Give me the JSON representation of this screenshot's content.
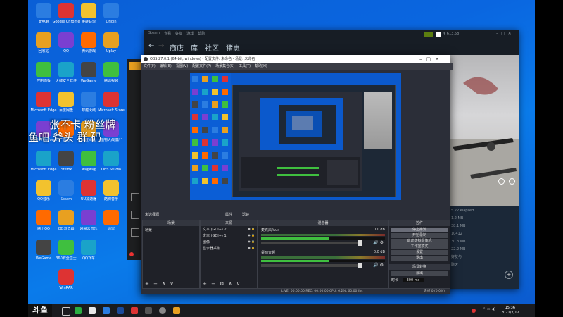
{
  "desktop": {
    "icons_col1": [
      "此电脑",
      "回收站",
      "控制面板",
      "Microsoft Edge",
      "NVIDIA GeForce Experience",
      "Microsoft Edge",
      "QQ音乐",
      "腾讯QQ",
      "WeGame"
    ],
    "icons_col2": [
      "Google Chrome",
      "QQ",
      "火绒安全软件",
      "百度网盘",
      "微信",
      "Firefox",
      "Steam",
      "QQ浏览器",
      "360安全卫士",
      "WinRAR"
    ],
    "icons_col3": [
      "英雄联盟",
      "腾讯游戏",
      "WeGame",
      "穿越火线",
      "百度网盘",
      "哔哩哔哩",
      "UU加速器",
      "网易云音乐",
      "QQ飞车"
    ],
    "icons_col4": [
      "Origin",
      "Uplay",
      "腾讯视频",
      "Microsoft Store",
      "植物大战僵尸",
      "OBS Studio",
      "酷狗音乐",
      "迅雷"
    ],
    "overlay_line1": "张不卡 粉丝牌",
    "overlay_line2": "鱼吧 斧头 群 码"
  },
  "steam": {
    "title_bar_items": [
      "Steam",
      "查看",
      "好友",
      "游戏",
      "帮助"
    ],
    "nav_back": "←",
    "nav_forward": "→",
    "nav_items": [
      "商店",
      "库",
      "社区",
      "猪崽"
    ],
    "user_balance": "¥ 613.58",
    "side_texts": [
      "5.22 elapsed",
      "1.2 MB",
      "38.1 MB",
      "10412",
      "30.3 MB",
      "22.2 MB",
      "好友与",
      "聊天"
    ]
  },
  "obs": {
    "title": "OBS 27.0.1 (64-bit, windows) - 配置文件: 未命名 - 场景: 未命名",
    "menu": [
      "文件(F)",
      "编辑(E)",
      "视图(V)",
      "配置文件(P)",
      "场景集合(S)",
      "工具(T)",
      "帮助(H)"
    ],
    "no_source_selected": "未选择源",
    "properties_btn": "属性",
    "filters_btn": "滤镜",
    "panels": {
      "scenes": "场景",
      "sources": "来源",
      "mixer": "混音器",
      "transitions": "场景转换",
      "controls": "控件"
    },
    "scene_item": "场景",
    "sources_list": [
      "文本 (GDI+) 2",
      "文本 (GDI+) 1",
      "图像",
      "显示器采集"
    ],
    "mixer_tracks": [
      {
        "name": "麦克风/Aux",
        "level": "0.0 dB"
      },
      {
        "name": "桌面音频",
        "level": "0.0 dB"
      }
    ],
    "controls": [
      "停止推流",
      "开始录制",
      "启动虚拟摄像机",
      "工作室模式",
      "设置",
      "退出"
    ],
    "transition_name": "淡出",
    "duration_label": "时长",
    "duration_value": "300 ms",
    "status": "LIVE: 00:00:00   REC: 00:00:00   CPU: 6.2%, 60.00 fps",
    "status_right": "丢帧 0 (0.0%)"
  },
  "taskbar": {
    "clock_time": "15:36",
    "clock_date": "2021/7/12"
  },
  "watermark": "斗鱼",
  "colors": {
    "obs_bg": "#2b2e38",
    "steam_bg": "#1b2838",
    "desktop_blue": "#0a66e0"
  }
}
